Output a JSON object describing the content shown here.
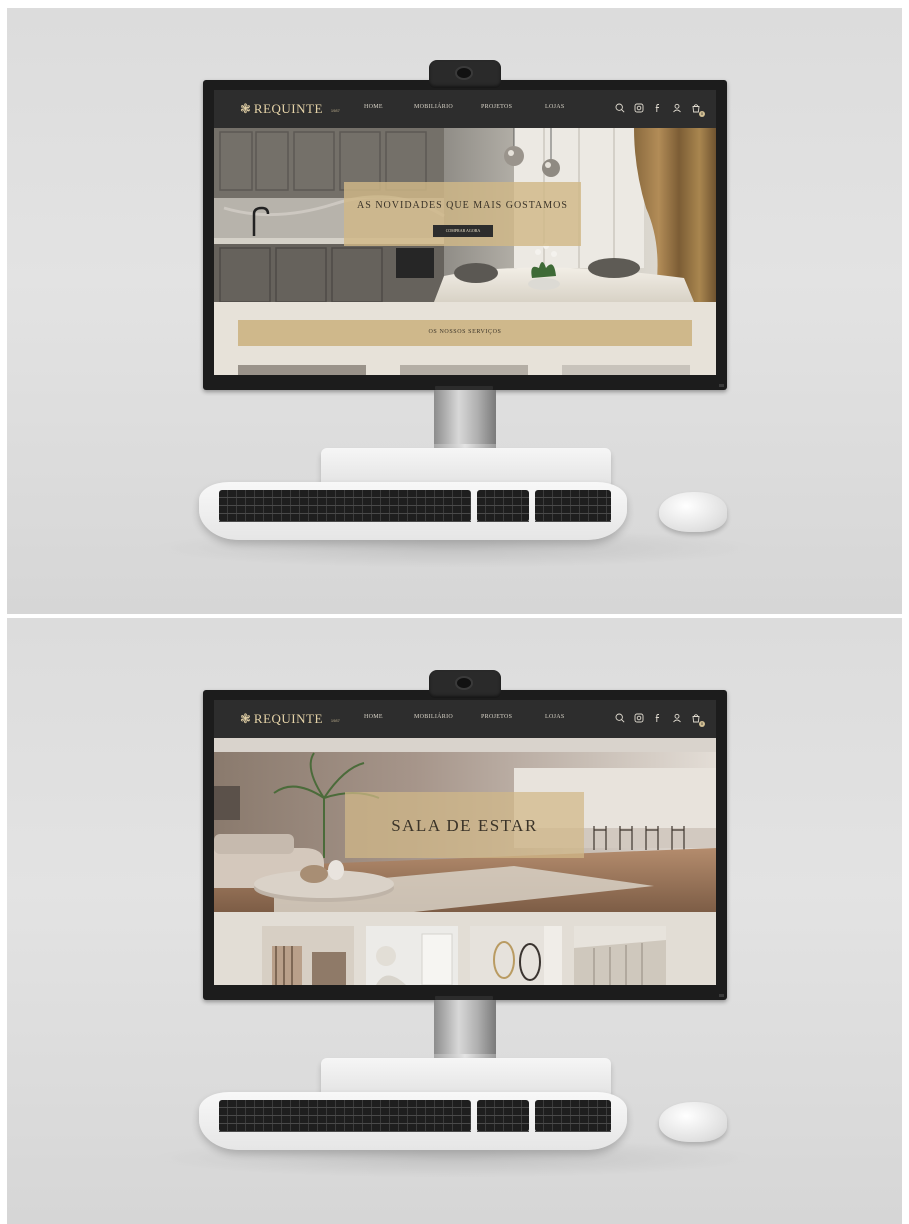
{
  "site": {
    "logo_word": "REQUINTE",
    "logo_sub": "1987",
    "menu": [
      "HOME",
      "MOBILIÁRIO",
      "PROJETOS",
      "LOJAS"
    ],
    "icons": [
      "search-icon",
      "instagram-icon",
      "facebook-icon",
      "user-icon",
      "cart-icon"
    ],
    "cart_count": "0"
  },
  "screen1": {
    "hero_title": "AS NOVIDADES QUE MAIS GOSTAMOS",
    "hero_button": "COMPRAR AGORA",
    "section_title": "OS NOSSOS SERVIÇOS"
  },
  "screen2": {
    "hero_title": "SALA DE ESTAR"
  },
  "colors": {
    "nav_bg": "#2d2d2d",
    "gold": "#d1b888",
    "section_bg": "#e7e2d9"
  }
}
